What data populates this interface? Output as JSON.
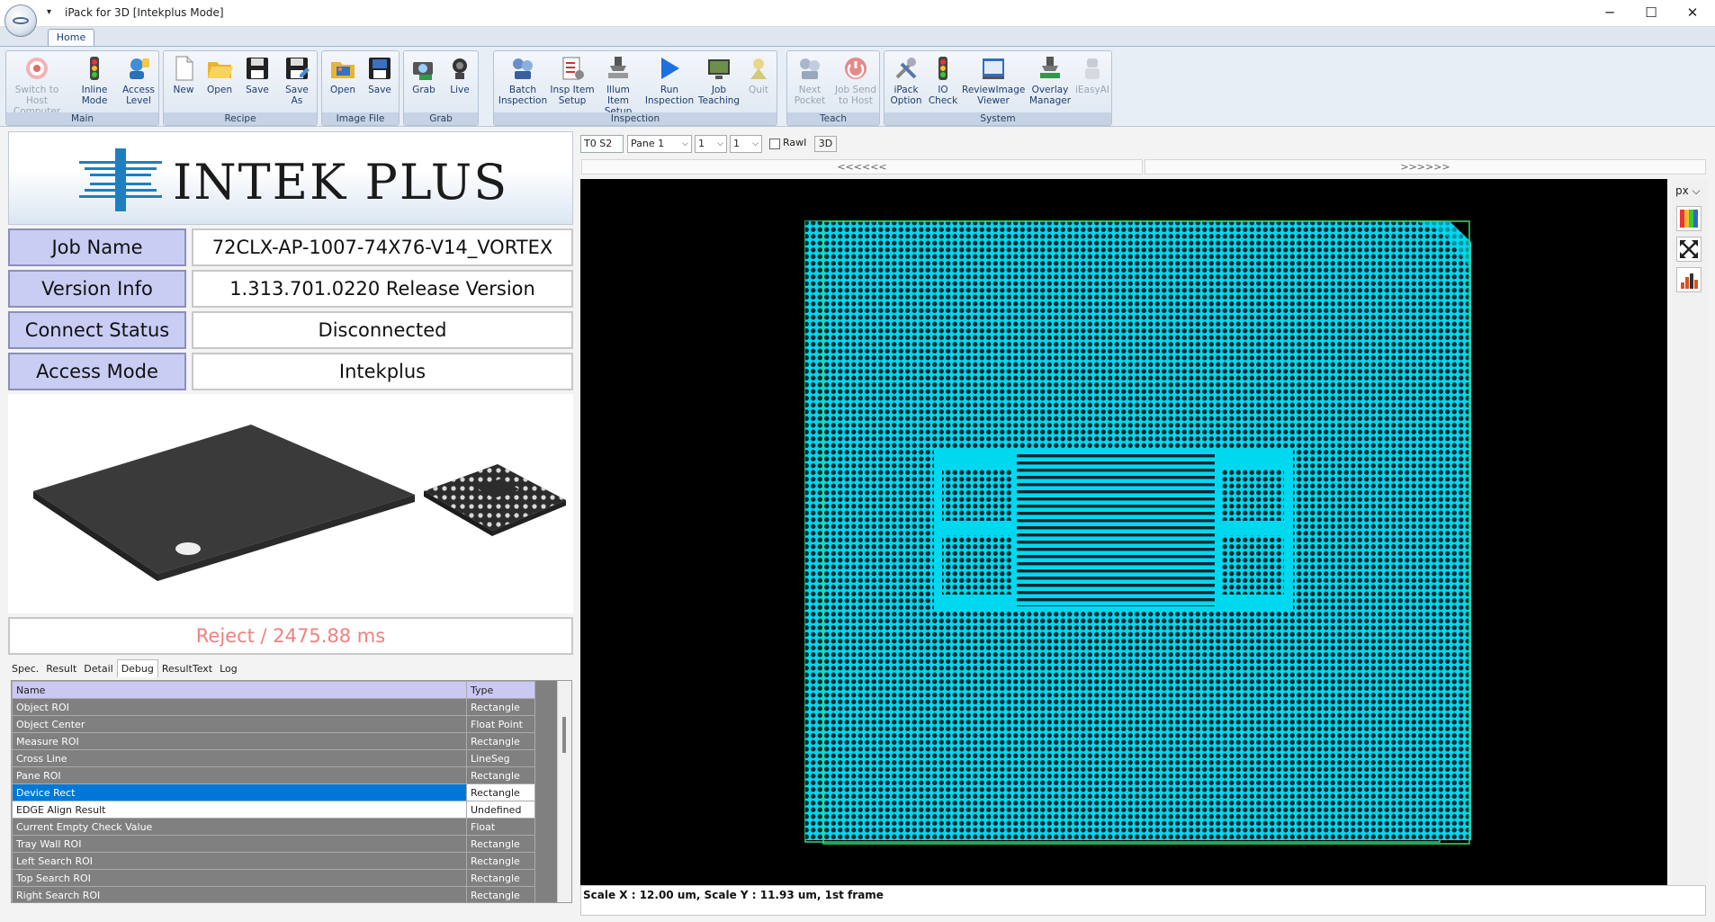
{
  "window": {
    "title": "iPack for 3D [Intekplus Mode]",
    "qat_arrow": "▾",
    "minimize": "─",
    "maximize": "☐",
    "close": "✕"
  },
  "ribbon": {
    "tab": "Home",
    "groups": {
      "main": {
        "label": "Main",
        "buttons": [
          "Switch to Host Computer",
          "Inline Mode",
          "Access Level"
        ]
      },
      "recipe": {
        "label": "Recipe",
        "buttons": [
          "New",
          "Open",
          "Save",
          "Save As"
        ]
      },
      "image_file": {
        "label": "Image File",
        "buttons": [
          "Open",
          "Save"
        ]
      },
      "grab": {
        "label": "Grab",
        "buttons": [
          "Grab",
          "Live"
        ]
      },
      "inspection": {
        "label": "Inspection",
        "buttons": [
          "Batch Inspection",
          "Insp Item Setup",
          "Illum Item Setup",
          "Run Inspection",
          "Job Teaching",
          "Quit"
        ]
      },
      "teach": {
        "label": "Teach",
        "buttons": [
          "Next Pocket",
          "Job Send to Host"
        ]
      },
      "system": {
        "label": "System",
        "buttons": [
          "iPack Option",
          "IO Check",
          "ReviewImage Viewer",
          "Overlay Manager",
          "iEasyAI"
        ]
      }
    }
  },
  "logo": {
    "text": "INTEK PLUS"
  },
  "info": {
    "job_name": {
      "label": "Job Name",
      "value": "72CLX-AP-1007-74X76-V14_VORTEX"
    },
    "version": {
      "label": "Version Info",
      "value": "1.313.701.0220 Release Version"
    },
    "connect": {
      "label": "Connect Status",
      "value": "Disconnected"
    },
    "access": {
      "label": "Access Mode",
      "value": "Intekplus"
    }
  },
  "result": "Reject / 2475.88 ms",
  "tabs": [
    "Spec.",
    "Result",
    "Detail",
    "Debug",
    "ResultText",
    "Log"
  ],
  "grid": {
    "headers": [
      "Name",
      "Type"
    ],
    "rows": [
      [
        "Object ROI",
        "Rectangle"
      ],
      [
        "Object Center",
        "Float Point"
      ],
      [
        "Measure ROI",
        "Rectangle"
      ],
      [
        "Cross Line",
        "LineSeg"
      ],
      [
        "Pane ROI",
        "Rectangle"
      ],
      [
        "Device Rect",
        "Rectangle"
      ],
      [
        "EDGE Align Result",
        "Undefined"
      ],
      [
        "Current Empty Check Value",
        "Float"
      ],
      [
        "Tray Wall ROI",
        "Rectangle"
      ],
      [
        "Left Search ROI",
        "Rectangle"
      ],
      [
        "Top Search ROI",
        "Rectangle"
      ],
      [
        "Right Search ROI",
        "Rectangle"
      ]
    ]
  },
  "viewer": {
    "frame_input": "T0 S2",
    "pane_select": "Pane 1",
    "sel_a": "1",
    "sel_b": "1",
    "raw_label": "RawI",
    "btn_3d": "3D",
    "nav_prev": "<<<<<<",
    "nav_next": ">>>>>>",
    "unit": "px",
    "status": "Scale X : 12.00 um, Scale Y : 11.93 um, 1st frame"
  },
  "colors": {
    "accent": "#0078d7",
    "die_cyan": "#00d8f0",
    "label_bg": "#c9cdf4",
    "reject": "#f08080"
  }
}
